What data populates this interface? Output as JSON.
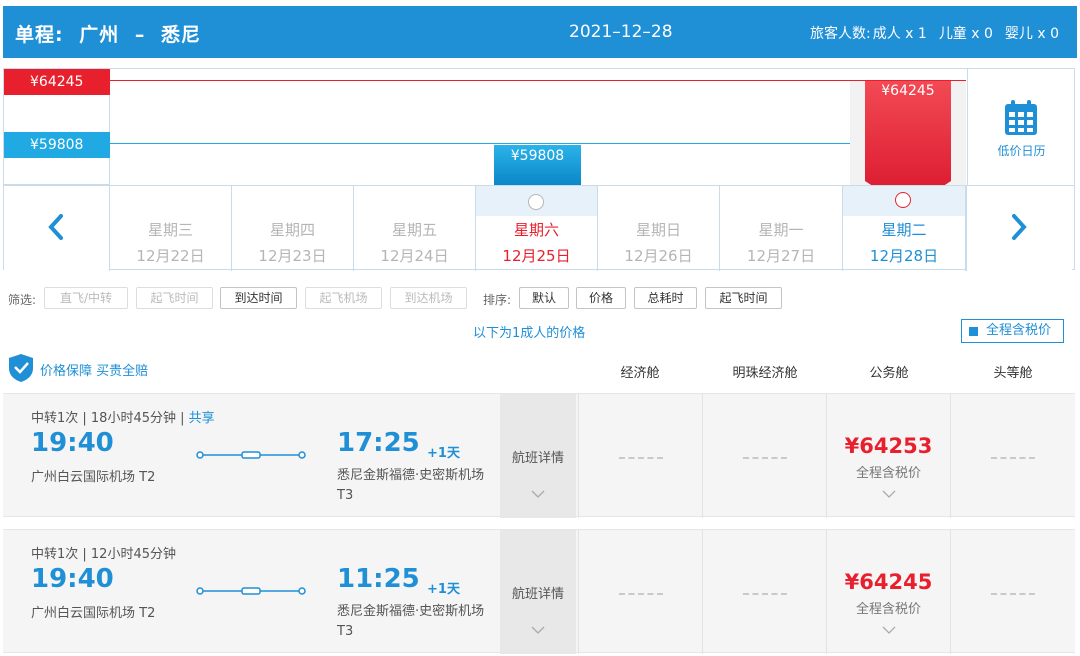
{
  "header": {
    "trip_type": "单程:",
    "origin": "广州",
    "separator": "–",
    "destination": "悉尼",
    "date": "2021–12–28",
    "passengers_label": "旅客人数:",
    "adult": "成人 x 1",
    "child": "儿童 x 0",
    "infant": "婴儿 x 0"
  },
  "calendar": {
    "ref_high_price": "¥64245",
    "ref_low_price": "¥59808",
    "bar_sat_price": "¥59808",
    "bar_tue_price": "¥64245",
    "low_price_calendar_label": "低价日历",
    "days": [
      {
        "weekday": "星期三",
        "date": "12月22日"
      },
      {
        "weekday": "星期四",
        "date": "12月23日"
      },
      {
        "weekday": "星期五",
        "date": "12月24日"
      },
      {
        "weekday": "星期六",
        "date": "12月25日"
      },
      {
        "weekday": "星期日",
        "date": "12月26日"
      },
      {
        "weekday": "星期一",
        "date": "12月27日"
      },
      {
        "weekday": "星期二",
        "date": "12月28日"
      }
    ],
    "colors": {
      "red": "#e8202d",
      "blue": "#1f8fd6",
      "light_blue": "#21a9e3"
    }
  },
  "filters": {
    "filter_label": "筛选:",
    "filter_items": [
      "直飞/中转",
      "起飞时间",
      "到达时间",
      "起飞机场",
      "到达机场"
    ],
    "sort_label": "排序:",
    "sort_items": [
      "默认",
      "价格",
      "总耗时",
      "起飞时间"
    ],
    "price_note": "以下为1成人的价格",
    "tax_toggle": "全程含税价"
  },
  "table": {
    "guarantee": "价格保障 买贵全赔",
    "columns": [
      "经济舱",
      "明珠经济舱",
      "公务舱",
      "头等舱"
    ]
  },
  "flights": [
    {
      "meta": "中转1次 | 18小时45分钟 | ",
      "share": "共享",
      "dep_time": "19:40",
      "dep_airport": "广州白云国际机场 T2",
      "arr_time": "17:25",
      "plus_day": "+1天",
      "arr_airport": "悉尼金斯福德·史密斯机场 T3",
      "detail": "航班详情",
      "business_price": "¥64253",
      "tax_note": "全程含税价"
    },
    {
      "meta": "中转1次 | 12小时45分钟",
      "share": "",
      "dep_time": "19:40",
      "dep_airport": "广州白云国际机场 T2",
      "arr_time": "11:25",
      "plus_day": "+1天",
      "arr_airport": "悉尼金斯福德·史密斯机场 T3",
      "detail": "航班详情",
      "business_price": "¥64245",
      "tax_note": "全程含税价"
    }
  ]
}
